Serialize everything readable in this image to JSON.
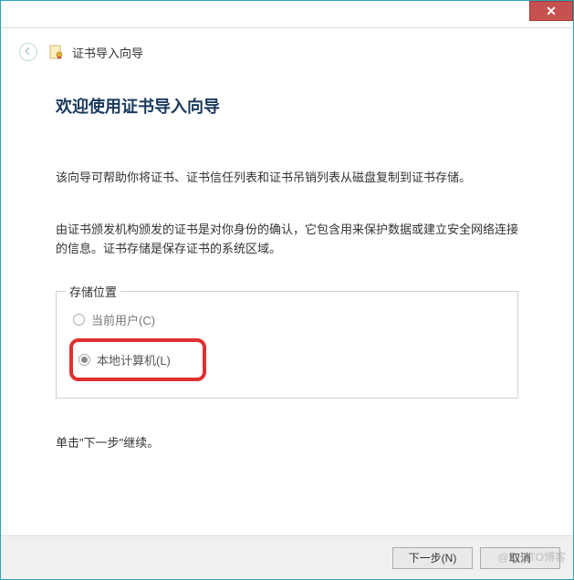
{
  "titlebar": {
    "close_label": "✕"
  },
  "header": {
    "title": "证书导入向导"
  },
  "main": {
    "heading": "欢迎使用证书导入向导",
    "paragraph1": "该向导可帮助你将证书、证书信任列表和证书吊销列表从磁盘复制到证书存储。",
    "paragraph2": "由证书颁发机构颁发的证书是对你身份的确认，它包含用来保护数据或建立安全网络连接的信息。证书存储是保存证书的系统区域。",
    "storage": {
      "legend": "存储位置",
      "option_current_user": "当前用户(C)",
      "option_local_machine": "本地计算机(L)"
    },
    "continue_hint": "单击\"下一步\"继续。"
  },
  "buttons": {
    "next": "下一步(N)",
    "cancel": "取消"
  },
  "watermark": "@51CTO博客"
}
